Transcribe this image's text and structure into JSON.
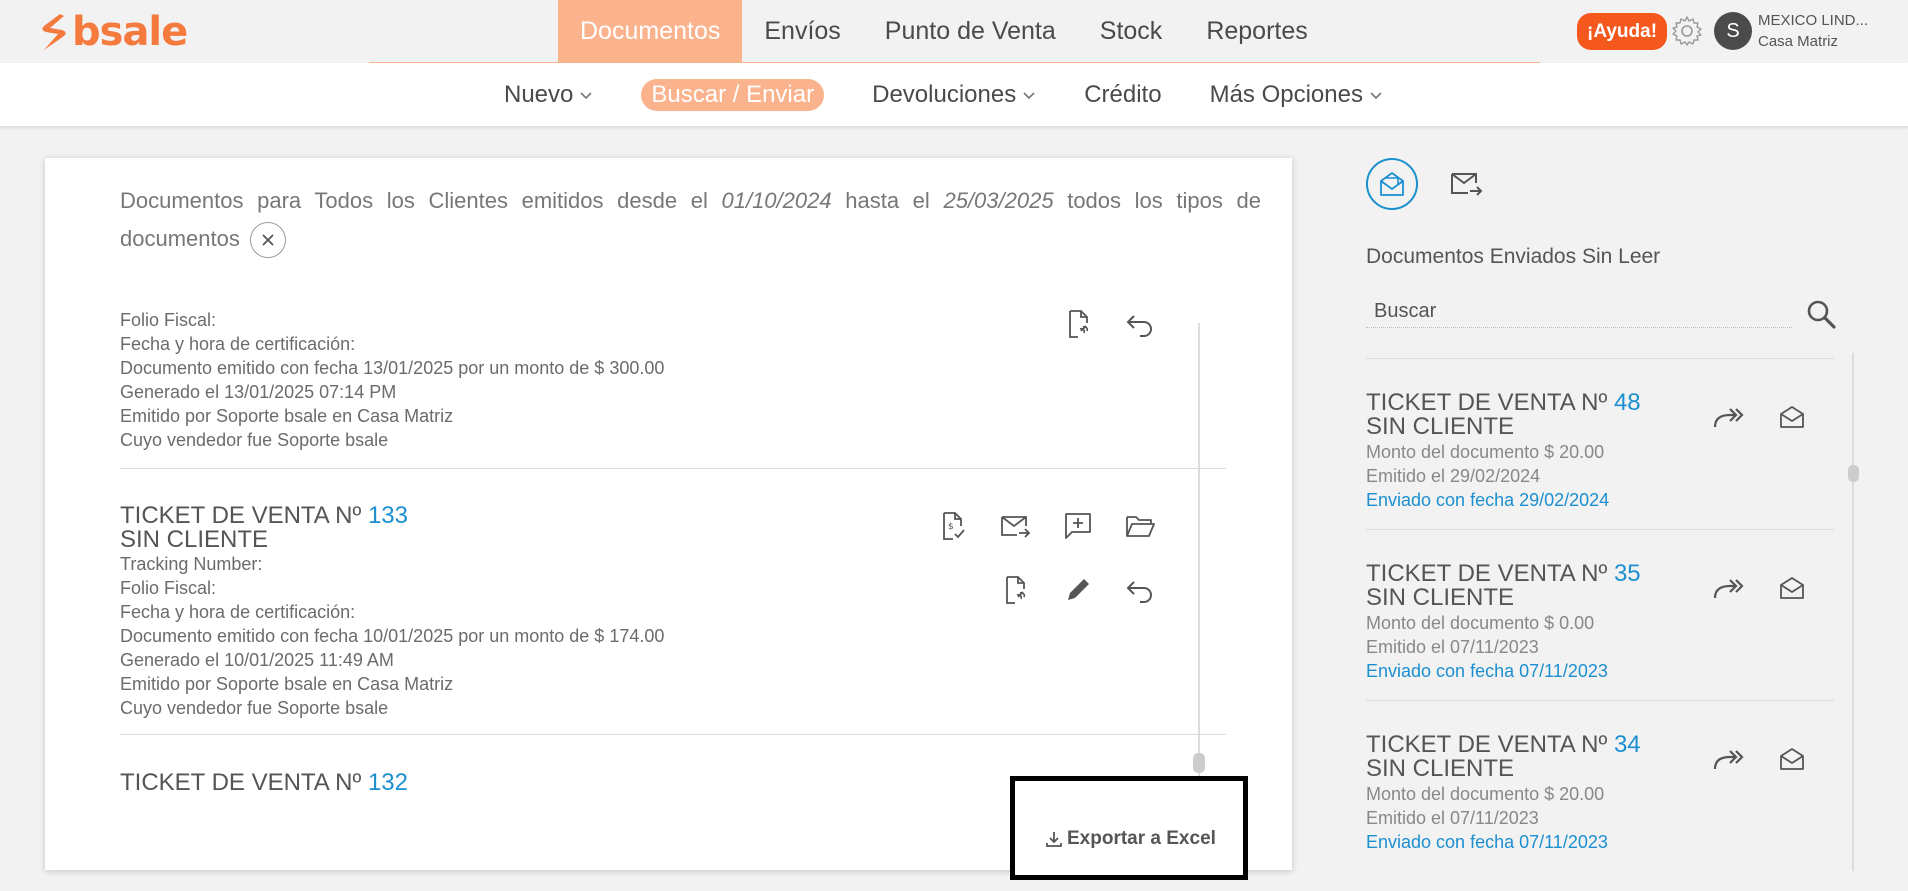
{
  "brand": {
    "name": "bsale",
    "color": "#f47a3e"
  },
  "main_nav": [
    {
      "label": "Documentos",
      "active": true
    },
    {
      "label": "Envíos"
    },
    {
      "label": "Punto de Venta"
    },
    {
      "label": "Stock"
    },
    {
      "label": "Reportes"
    }
  ],
  "header": {
    "help_label": "¡Ayuda!",
    "avatar_letter": "S",
    "company": "MEXICO LIND...",
    "branch": "Casa Matriz",
    "gear_icon": "gear-icon"
  },
  "sub_nav": [
    {
      "label": "Nuevo",
      "dropdown": true
    },
    {
      "label": "Buscar / Enviar",
      "active": true
    },
    {
      "label": "Devoluciones",
      "dropdown": true
    },
    {
      "label": "Crédito"
    },
    {
      "label": "Más Opciones",
      "dropdown": true
    }
  ],
  "filter": {
    "prefix": "Documentos para Todos los Clientes emitidos desde el",
    "date_from": "01/10/2024",
    "mid": "hasta el",
    "date_to": "25/03/2025",
    "suffix": "todos los tipos de documentos"
  },
  "documents": [
    {
      "lines": [
        "Folio Fiscal:",
        "Fecha y hora de certificación:",
        "Documento emitido con fecha 13/01/2025 por un monto de $ 300.00",
        "Generado el 13/01/2025 07:14 PM",
        "Emitido por Soporte bsale en Casa Matriz",
        "Cuyo vendedor fue Soporte bsale"
      ]
    },
    {
      "title": "TICKET DE VENTA Nº",
      "number": "133",
      "client": "SIN CLIENTE",
      "lines": [
        "Tracking Number:",
        "Folio Fiscal:",
        "Fecha y hora de certificación:",
        "Documento emitido con fecha 10/01/2025 por un monto de $ 174.00",
        "Generado el 10/01/2025 11:49 AM",
        "Emitido por Soporte bsale en Casa Matriz",
        "Cuyo vendedor fue Soporte bsale"
      ]
    },
    {
      "title": "TICKET DE VENTA Nº",
      "number": "132"
    }
  ],
  "export_label": "Exportar a Excel",
  "right_panel": {
    "title": "Documentos Enviados Sin Leer",
    "search_placeholder": "Buscar",
    "items": [
      {
        "title": "TICKET DE VENTA Nº",
        "number": "48",
        "client": "SIN CLIENTE",
        "amount": "Monto del documento $ 20.00",
        "issued": "Emitido el 29/02/2024",
        "sent": "Enviado con fecha 29/02/2024"
      },
      {
        "title": "TICKET DE VENTA Nº",
        "number": "35",
        "client": "SIN CLIENTE",
        "amount": "Monto del documento $ 0.00",
        "issued": "Emitido el 07/11/2023",
        "sent": "Enviado con fecha 07/11/2023"
      },
      {
        "title": "TICKET DE VENTA Nº",
        "number": "34",
        "client": "SIN CLIENTE",
        "amount": "Monto del documento $ 20.00",
        "issued": "Emitido el 07/11/2023",
        "sent": "Enviado con fecha 07/11/2023"
      }
    ]
  },
  "colors": {
    "accent": "#fbb38d",
    "link": "#1c8fd1",
    "help": "#f4581d"
  }
}
